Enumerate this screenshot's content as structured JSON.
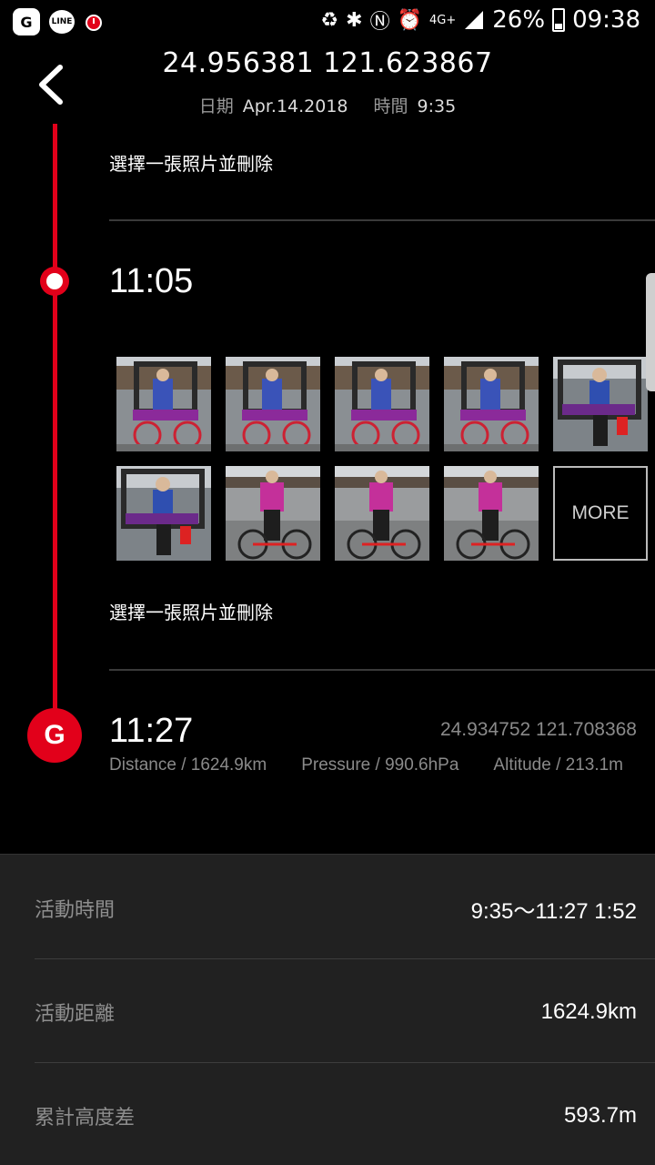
{
  "status_bar": {
    "apps": [
      "G",
      "LINE"
    ],
    "network": "4G+",
    "battery": "26%",
    "time": "09:38"
  },
  "header": {
    "coords": "24.956381 121.623867",
    "date_label": "日期",
    "date_value": "Apr.14.2018",
    "time_label": "時間",
    "time_value": "9:35"
  },
  "timeline": {
    "select_delete_1": "選擇一張照片並刪除",
    "checkpoint_time": "11:05",
    "more_label": "MORE",
    "select_delete_2": "選擇一張照片並刪除",
    "goal_icon_letter": "G",
    "goal_time": "11:27",
    "goal_coords": "24.934752 121.708368",
    "goal_distance": "Distance / 1624.9km",
    "goal_pressure": "Pressure / 990.6hPa",
    "goal_altitude": "Altitude / 213.1m"
  },
  "summary": {
    "rows": [
      {
        "label": "活動時間",
        "value": "9:35～11:27 1:52"
      },
      {
        "label": "活動距離",
        "value": "1624.9km"
      },
      {
        "label": "累計高度差",
        "value": "593.7m"
      }
    ]
  },
  "colors": {
    "accent": "#e2001a",
    "background": "#000000",
    "panel": "#212121"
  }
}
